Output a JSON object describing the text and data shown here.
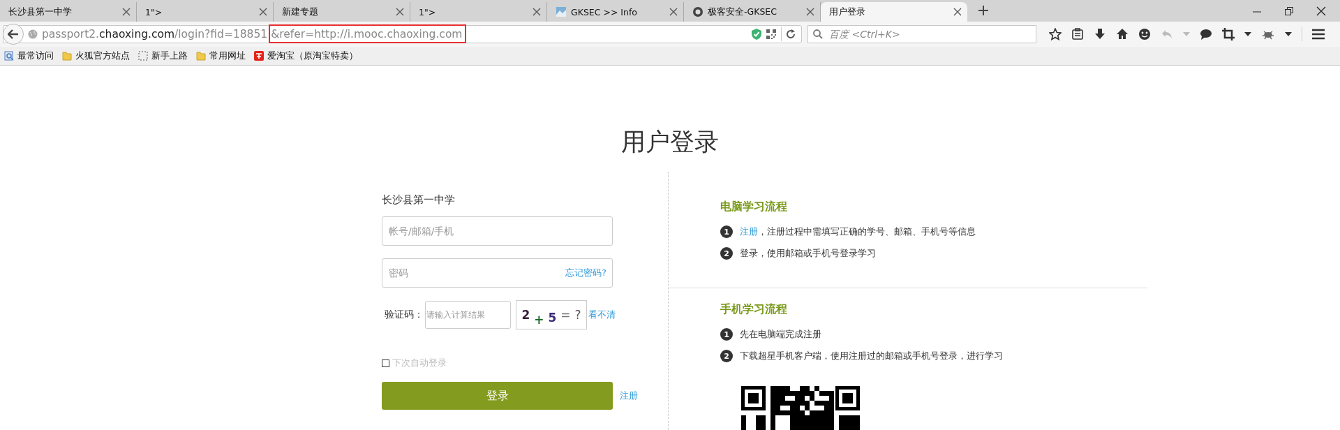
{
  "tabs": [
    {
      "title": "长沙县第一中学",
      "selected": false
    },
    {
      "title": "1\">",
      "selected": false
    },
    {
      "title": "新建专题",
      "selected": false
    },
    {
      "title": "1\">",
      "selected": false
    },
    {
      "title": "GKSEC >> Info",
      "kind": "image",
      "selected": false
    },
    {
      "title": "极客安全-GKSEC",
      "kind": "round",
      "selected": false
    },
    {
      "title": "用户登录",
      "selected": true
    }
  ],
  "address": {
    "host_prefix": "passport2.",
    "domain": "chaoxing.com",
    "path": "/login?fid=18851",
    "highlighted_part": "&refer=http://i.mooc.chaoxing.com"
  },
  "search": {
    "placeholder": "百度 <Ctrl+K>"
  },
  "bookmarks": [
    {
      "label": "最常访问",
      "kind": "page"
    },
    {
      "label": "火狐官方站点",
      "kind": "folder"
    },
    {
      "label": "新手上路",
      "kind": "dashed"
    },
    {
      "label": "常用网址",
      "kind": "folder"
    },
    {
      "label": "爱淘宝（原淘宝特卖）",
      "kind": "shop"
    }
  ],
  "page": {
    "title": "用户登录",
    "login": {
      "school": "长沙县第一中学",
      "account_placeholder": "帐号/邮箱/手机",
      "password_placeholder": "密码",
      "forgot_link": "忘记密码?",
      "captcha_label": "验证码：",
      "captcha_placeholder": "请输入计算结果",
      "captcha_tokens": [
        "2",
        "+",
        "5",
        "=",
        "?"
      ],
      "refresh_link": "看不清",
      "remember_me": {
        "label": "下次自动登录",
        "checked": false
      },
      "login_button": "登录",
      "register_link": "注册"
    },
    "sections": [
      {
        "heading": "电脑学习流程",
        "steps": [
          {
            "number": "1",
            "link": "注册",
            "text": "，注册过程中需填写正确的学号、邮箱、手机号等信息"
          },
          {
            "number": "2",
            "text": "登录，使用邮箱或手机号登录学习"
          }
        ]
      },
      {
        "heading": "手机学习流程",
        "steps": [
          {
            "number": "1",
            "text": "先在电脑端完成注册"
          },
          {
            "number": "2",
            "text": "下载超星手机客户端，使用注册过的邮箱或手机号登录，进行学习"
          }
        ],
        "qr_code": true
      }
    ]
  }
}
